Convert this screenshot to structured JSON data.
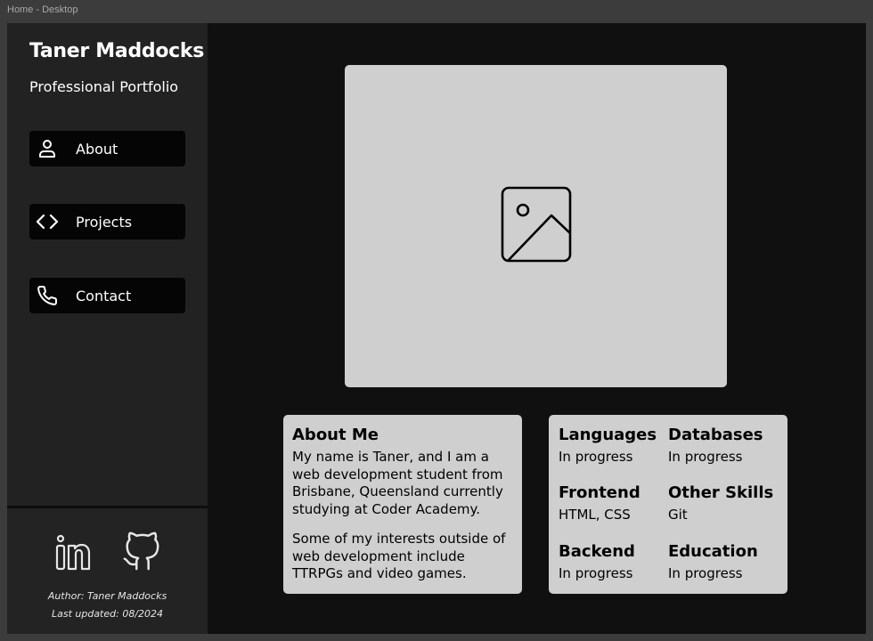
{
  "frame": {
    "label": "Home - Desktop"
  },
  "sidebar": {
    "name": "Taner Maddocks",
    "subtitle": "Professional Portfolio",
    "nav": [
      {
        "label": "About",
        "icon": "user-icon"
      },
      {
        "label": "Projects",
        "icon": "code-icon"
      },
      {
        "label": "Contact",
        "icon": "phone-icon"
      }
    ],
    "footer": {
      "socials": [
        {
          "icon": "linkedin-icon"
        },
        {
          "icon": "github-icon"
        }
      ],
      "author": "Author: Taner Maddocks",
      "updated": "Last updated: 08/2024"
    }
  },
  "main": {
    "hero": {
      "icon": "image-placeholder-icon"
    },
    "about": {
      "title": "About Me",
      "paragraphs": [
        "My name is Taner, and I am a web development student from Brisbane, Queensland currently studying at Coder Academy.",
        "Some of my interests outside of web development include TTRPGs and video games."
      ]
    },
    "skills": [
      {
        "title": "Languages",
        "value": "In progress"
      },
      {
        "title": "Databases",
        "value": "In progress"
      },
      {
        "title": "Frontend",
        "value": "HTML, CSS"
      },
      {
        "title": "Other Skills",
        "value": "Git"
      },
      {
        "title": "Backend",
        "value": "In progress"
      },
      {
        "title": "Education",
        "value": "In progress"
      }
    ]
  },
  "colors": {
    "background": "#101010",
    "sidebar": "#222222",
    "card": "#cfcfcf",
    "nav_button": "#050505"
  }
}
